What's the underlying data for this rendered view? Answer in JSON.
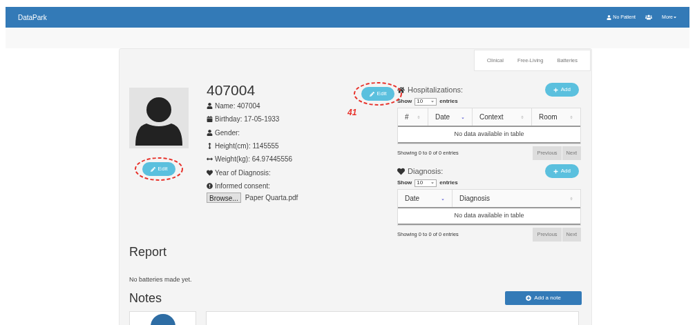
{
  "navbar": {
    "brand": "DataPark",
    "patient": "No Patient",
    "more": "More"
  },
  "tabs": [
    {
      "label": "Clinical",
      "selected": false
    },
    {
      "label": "Free-Living",
      "selected": false
    },
    {
      "label": "Batteries",
      "selected": false
    }
  ],
  "patient": {
    "id": "407004",
    "fields": [
      {
        "kind": "user",
        "text": "Name: 407004"
      },
      {
        "kind": "calendar",
        "text": "Birthday: 17-05-1933"
      },
      {
        "kind": "user",
        "text": "Gender:"
      },
      {
        "kind": "height",
        "text": "Height(cm): 1145555"
      },
      {
        "kind": "width",
        "text": "Weight(kg): 64.97445556"
      },
      {
        "kind": "heart",
        "text": "Year of Diagnosis:"
      },
      {
        "kind": "info",
        "text": "Informed consent:"
      }
    ],
    "browse": "Browse...",
    "file": "Paper Quarta.pdf",
    "edit": "Edit"
  },
  "annotation": {
    "edit": "Edit",
    "number": "41"
  },
  "tables": [
    {
      "title": "Hospitalizations:",
      "kind": "home",
      "add": "Add",
      "show": "Show",
      "page_size": "10",
      "entries": "entries",
      "columns": [
        {
          "label": "#",
          "sorted": false
        },
        {
          "label": "Date",
          "sorted": true
        },
        {
          "label": "Context",
          "sorted": false
        },
        {
          "label": "Room",
          "sorted": false
        }
      ],
      "empty": "No data available in table",
      "info": "Showing 0 to 0 of 0 entries",
      "previous": "Previous",
      "next": "Next"
    },
    {
      "title": "Diagnosis:",
      "kind": "heart",
      "add": "Add",
      "show": "Show",
      "page_size": "10",
      "entries": "entries",
      "columns": [
        {
          "label": "Date",
          "sorted": true
        },
        {
          "label": "Diagnosis",
          "sorted": false
        }
      ],
      "empty": "No data available in table",
      "info": "Showing 0 to 0 of 0 entries",
      "previous": "Previous",
      "next": "Next"
    }
  ],
  "report": {
    "title": "Report",
    "text": "No batteries made yet."
  },
  "notes": {
    "title": "Notes",
    "add": "Add a note"
  }
}
